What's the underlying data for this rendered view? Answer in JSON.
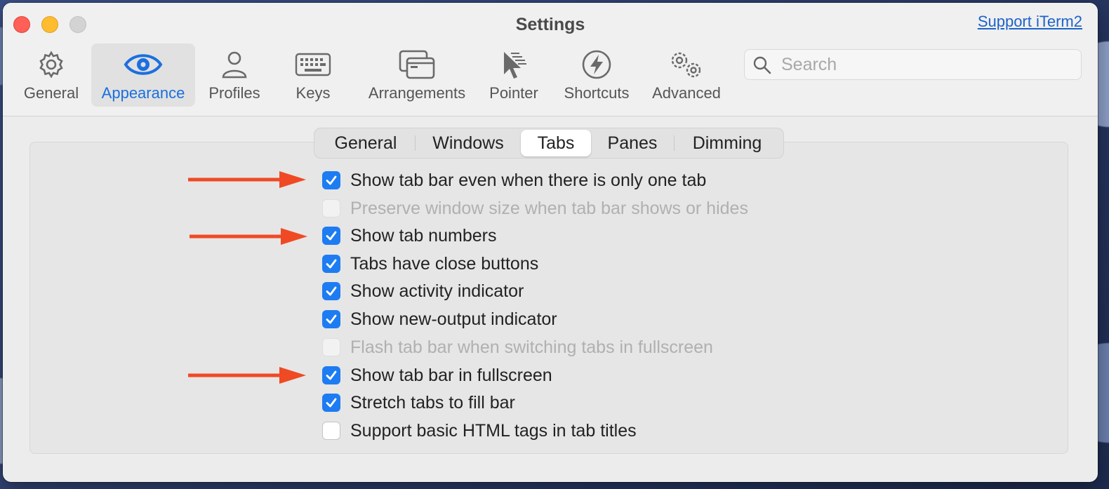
{
  "window": {
    "title": "Settings",
    "support_link": "Support iTerm2"
  },
  "toolbar": {
    "items": [
      {
        "label": "General",
        "icon": "gear-icon"
      },
      {
        "label": "Appearance",
        "icon": "eye-icon",
        "selected": true
      },
      {
        "label": "Profiles",
        "icon": "person-icon"
      },
      {
        "label": "Keys",
        "icon": "keyboard-icon"
      },
      {
        "label": "Arrangements",
        "icon": "windows-icon"
      },
      {
        "label": "Pointer",
        "icon": "pointer-icon"
      },
      {
        "label": "Shortcuts",
        "icon": "bolt-icon"
      },
      {
        "label": "Advanced",
        "icon": "gears-icon"
      }
    ]
  },
  "search": {
    "placeholder": "Search",
    "value": ""
  },
  "subtabs": {
    "items": [
      "General",
      "Windows",
      "Tabs",
      "Panes",
      "Dimming"
    ],
    "selected": "Tabs"
  },
  "options": [
    {
      "label": "Show tab bar even when there is only one tab",
      "checked": true,
      "enabled": true,
      "highlighted": true
    },
    {
      "label": "Preserve window size when tab bar shows or hides",
      "checked": false,
      "enabled": false
    },
    {
      "label": "Show tab numbers",
      "checked": true,
      "enabled": true,
      "highlighted": true
    },
    {
      "label": "Tabs have close buttons",
      "checked": true,
      "enabled": true
    },
    {
      "label": "Show activity indicator",
      "checked": true,
      "enabled": true
    },
    {
      "label": "Show new-output indicator",
      "checked": true,
      "enabled": true
    },
    {
      "label": "Flash tab bar when switching tabs in fullscreen",
      "checked": false,
      "enabled": false
    },
    {
      "label": "Show tab bar in fullscreen",
      "checked": true,
      "enabled": true,
      "highlighted": true
    },
    {
      "label": "Stretch tabs to fill bar",
      "checked": true,
      "enabled": true
    },
    {
      "label": "Support basic HTML tags in tab titles",
      "checked": false,
      "enabled": true
    }
  ],
  "colors": {
    "accent": "#1b6fe0",
    "checkbox_on": "#1d7cf2",
    "annotation_arrow": "#f04a24"
  }
}
